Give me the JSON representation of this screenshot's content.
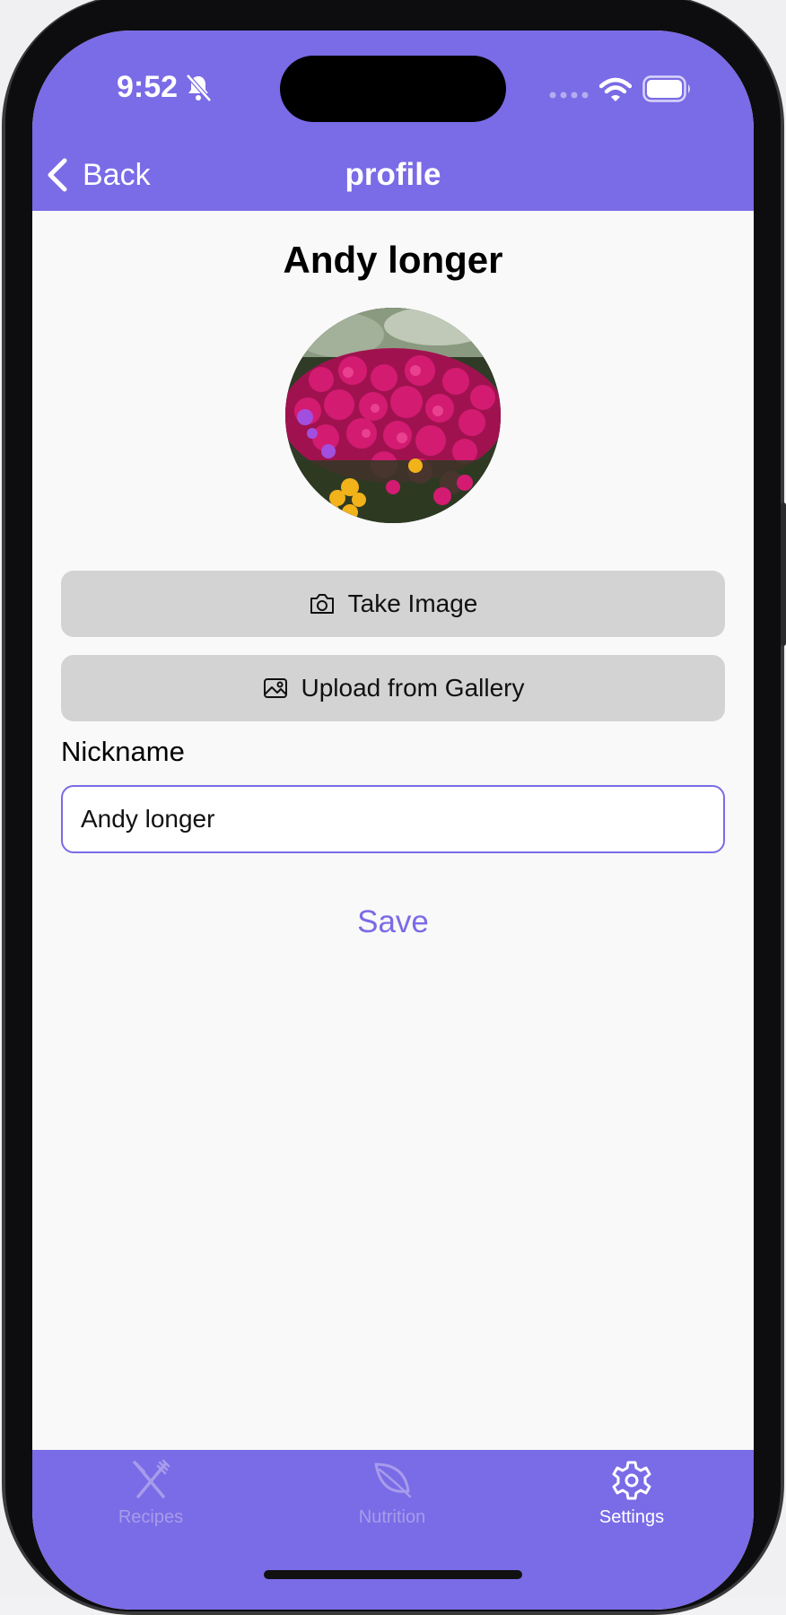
{
  "status_bar": {
    "time": "9:52",
    "icons": [
      "bell-slash-icon",
      "signal-icon",
      "wifi-icon",
      "battery-icon"
    ]
  },
  "nav": {
    "back_label": "Back",
    "title": "profile"
  },
  "profile": {
    "name": "Andy longer",
    "avatar": "flower-photo"
  },
  "actions": {
    "take_image_label": "Take Image",
    "upload_label": "Upload from Gallery"
  },
  "form": {
    "nickname_label": "Nickname",
    "nickname_value": "Andy longer",
    "save_label": "Save"
  },
  "tabbar": {
    "tabs": [
      {
        "label": "Recipes",
        "icon": "fork-knife-icon",
        "active": false
      },
      {
        "label": "Nutrition",
        "icon": "leaf-icon",
        "active": false
      },
      {
        "label": "Settings",
        "icon": "gear-icon",
        "active": true
      }
    ]
  },
  "colors": {
    "accent": "#7a6be6",
    "button_bg": "#d3d3d3",
    "screen_bg": "#f9f9f9",
    "tab_inactive": "#a79ceb",
    "tab_active": "#ffffff"
  }
}
